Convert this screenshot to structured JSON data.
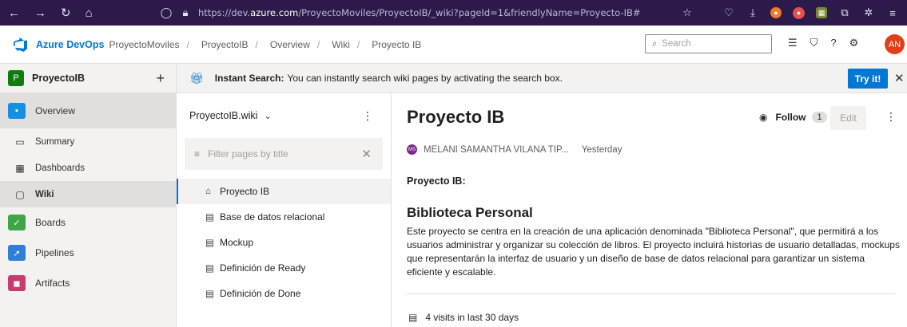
{
  "browser": {
    "url_prefix": "https://dev.",
    "url_domain": "azure.com",
    "url_rest": "/ProyectoMoviles/ProyectoIB/_wiki?pageId=1&friendlyName=Proyecto-IB#"
  },
  "header": {
    "brand": "Azure DevOps",
    "org": "ProyectoMoviles",
    "breadcrumbs": [
      "ProyectoIB",
      "Overview",
      "Wiki",
      "Proyecto IB"
    ],
    "search_placeholder": "Search",
    "avatar_initials": "AN"
  },
  "sidebar": {
    "project_initial": "P",
    "project_name": "ProyectoIB",
    "add_symbol": "+",
    "items": [
      {
        "label": "Overview"
      },
      {
        "label": "Summary"
      },
      {
        "label": "Dashboards"
      },
      {
        "label": "Wiki"
      },
      {
        "label": "Boards"
      },
      {
        "label": "Pipelines"
      },
      {
        "label": "Artifacts"
      }
    ]
  },
  "banner": {
    "title": "Instant Search:",
    "message": "You can instantly search wiki pages by activating the search box.",
    "button": "Try it!"
  },
  "wiki_tree": {
    "wiki_name": "ProyectoIB.wiki",
    "filter_placeholder": "Filter pages by title",
    "pages": [
      {
        "label": "Proyecto IB"
      },
      {
        "label": "Base de datos relacional"
      },
      {
        "label": "Mockup"
      },
      {
        "label": "Definición de Ready"
      },
      {
        "label": "Definición de Done"
      }
    ]
  },
  "page": {
    "title": "Proyecto IB",
    "follow_label": "Follow",
    "follow_count": "1",
    "edit_label": "Edit",
    "author_initials": "MS",
    "author": "MELANI SAMANTHA VILANA TIP...",
    "updated": "Yesterday",
    "section_label": "Proyecto IB:",
    "heading": "Biblioteca Personal",
    "body": "Este proyecto se centra en la creación de una aplicación denominada \"Biblioteca Personal\", que permitirá a los usuarios administrar y organizar su colección de libros. El proyecto incluirá historias de usuario detalladas, mockups que representarán la interfaz de usuario y un diseño de base de datos relacional para garantizar un sistema eficiente y escalable.",
    "visits": "4 visits in last 30 days"
  },
  "colors": {
    "browser_bar": "#2b1a4a",
    "accent": "#0078d4",
    "avatar": "#e43e18",
    "project_badge": "#107c10"
  }
}
